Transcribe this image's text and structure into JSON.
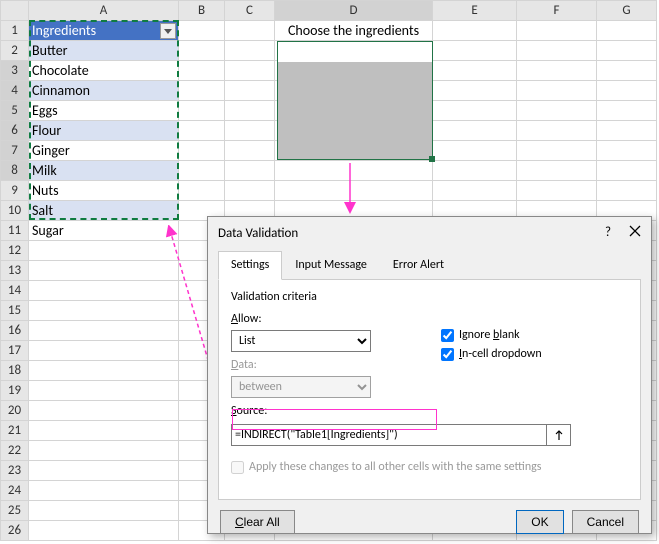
{
  "columns": [
    "A",
    "B",
    "C",
    "D",
    "E",
    "F",
    "G"
  ],
  "rows": [
    1,
    2,
    3,
    4,
    5,
    6,
    7,
    8,
    9,
    10,
    11,
    12,
    13,
    14,
    15,
    16,
    17,
    18,
    19,
    20,
    21,
    22,
    23,
    24,
    25,
    26
  ],
  "table": {
    "header": "Ingredients",
    "items": [
      "Butter",
      "Chocolate",
      "Cinnamon",
      "Eggs",
      "Flour",
      "Ginger",
      "Milk",
      "Nuts",
      "Salt",
      "Sugar"
    ]
  },
  "title_cell": "Choose the ingredients",
  "dialog": {
    "title": "Data Validation",
    "tabs": {
      "settings": "Settings",
      "input": "Input Message",
      "error": "Error Alert"
    },
    "criteria_group": "Validation criteria",
    "allow_label": "Allow:",
    "allow_value": "List",
    "data_label": "Data:",
    "data_value": "between",
    "ignore_blank": "Ignore blank",
    "incell_dd": "In-cell dropdown",
    "source_label": "Source:",
    "source_value": "=INDIRECT(\"Table1[Ingredients]\")",
    "apply_label": "Apply these changes to all other cells with the same settings",
    "clear": "Clear All",
    "ok": "OK",
    "cancel": "Cancel"
  },
  "chart_data": {
    "type": "table",
    "title": "Ingredients",
    "values": [
      "Butter",
      "Chocolate",
      "Cinnamon",
      "Eggs",
      "Flour",
      "Ginger",
      "Milk",
      "Nuts",
      "Salt",
      "Sugar"
    ]
  }
}
